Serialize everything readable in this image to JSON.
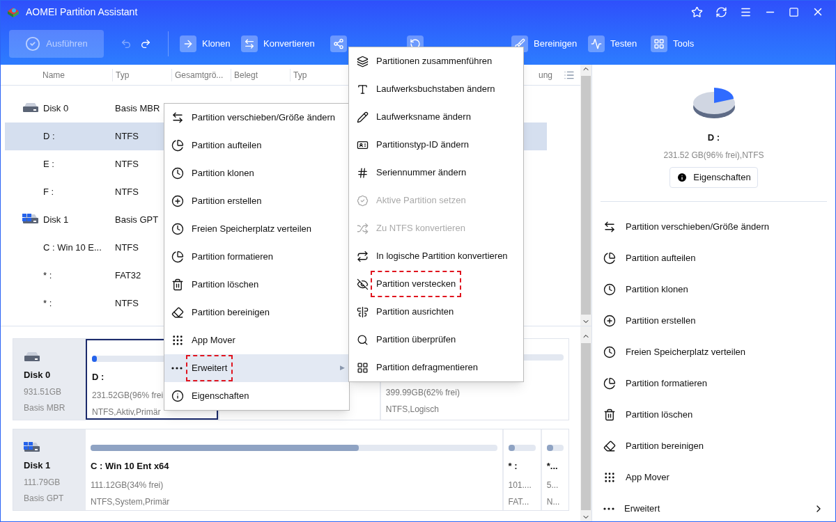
{
  "window": {
    "title": "AOMEI Partition Assistant"
  },
  "toolbar": {
    "apply": {
      "label": "Ausführen",
      "disabled": true
    },
    "undo": {
      "disabled": true
    },
    "redo": {
      "disabled": false
    },
    "items": [
      {
        "kind": "labeled",
        "label": "Klonen"
      },
      {
        "kind": "labeled",
        "label": "Konvertieren"
      },
      {
        "kind": "covered"
      },
      {
        "kind": "covered"
      },
      {
        "kind": "labeled",
        "label": "Bereinigen"
      },
      {
        "kind": "labeled",
        "label": "Testen"
      },
      {
        "kind": "labeled",
        "label": "Tools"
      }
    ]
  },
  "table": {
    "columns": [
      "Name",
      "Typ",
      "Gesamtgrö...",
      "Belegt",
      "Typ",
      "ung"
    ],
    "rows": [
      {
        "kind": "disk",
        "name": "Disk 0",
        "type": "Basis MBR",
        "selected": false
      },
      {
        "kind": "partition",
        "name": "D :",
        "type": "NTFS",
        "selected": true
      },
      {
        "kind": "partition",
        "name": "E :",
        "type": "NTFS",
        "selected": false
      },
      {
        "kind": "partition",
        "name": "F :",
        "type": "NTFS",
        "selected": false
      },
      {
        "kind": "disk",
        "name": "Disk 1",
        "type": "Basis GPT",
        "selected": false
      },
      {
        "kind": "partition",
        "name": "C : Win 10 E...",
        "type": "NTFS",
        "selected": false
      },
      {
        "kind": "partition",
        "name": "* :",
        "type": "FAT32",
        "selected": false
      },
      {
        "kind": "partition",
        "name": "* :",
        "type": "NTFS",
        "selected": false
      }
    ]
  },
  "disk_map": [
    {
      "name": "Disk 0",
      "size": "931.51GB",
      "style": "Basis MBR",
      "partitions": [
        {
          "selected": true,
          "level": 0.04,
          "label": "D :",
          "size": "231.52GB(96% frei",
          "fs": "NTFS,Aktiv,Primär"
        },
        {
          "selected": false
        },
        {
          "selected": false,
          "size": "399.99GB(62% frei)",
          "fs": "NTFS,Logisch"
        }
      ]
    },
    {
      "name": "Disk 1",
      "size": "111.79GB",
      "style": "Basis GPT",
      "partitions": [
        {
          "selected": false,
          "level": 0.66,
          "label": "C : Win 10 Ent x64",
          "size": "111.12GB(34% frei)",
          "fs": "NTFS,System,Primär"
        },
        {
          "selected": false,
          "level": 0.25,
          "label": "* :",
          "size": "101....",
          "fs": "FAT..."
        },
        {
          "selected": false,
          "level": 0.4,
          "label": "*...",
          "size": "5...",
          "fs": "N..."
        }
      ]
    }
  ],
  "context_menu": [
    {
      "label": "Partition verschieben/Größe ändern",
      "selected": false,
      "annotated": false
    },
    {
      "label": "Partition aufteilen",
      "selected": false,
      "annotated": false
    },
    {
      "label": "Partition klonen",
      "selected": false,
      "annotated": false
    },
    {
      "label": "Partition erstellen",
      "selected": false,
      "annotated": false
    },
    {
      "label": "Freien Speicherplatz verteilen",
      "selected": false,
      "annotated": false
    },
    {
      "label": "Partition formatieren",
      "selected": false,
      "annotated": false
    },
    {
      "label": "Partition löschen",
      "selected": false,
      "annotated": false
    },
    {
      "label": "Partition bereinigen",
      "selected": false,
      "annotated": false
    },
    {
      "label": "App Mover",
      "selected": false,
      "annotated": false
    },
    {
      "label": "Erweitert",
      "selected": true,
      "annotated": true,
      "arrow": "▶"
    },
    {
      "label": "Eigenschaften",
      "selected": false,
      "annotated": false
    }
  ],
  "submenu": [
    {
      "label": "Partitionen zusammenführen",
      "disabled": false,
      "annotated": false
    },
    {
      "label": "Laufwerksbuchstaben ändern",
      "disabled": false,
      "annotated": false
    },
    {
      "label": "Laufwerksname ändern",
      "disabled": false,
      "annotated": false
    },
    {
      "label": "Partitionstyp-ID ändern",
      "disabled": false,
      "annotated": false
    },
    {
      "label": "Seriennummer ändern",
      "disabled": false,
      "annotated": false
    },
    {
      "label": "Aktive Partition setzen",
      "disabled": true,
      "annotated": false
    },
    {
      "label": "Zu NTFS konvertieren",
      "disabled": true,
      "annotated": false
    },
    {
      "label": "In logische Partition konvertieren",
      "disabled": false,
      "annotated": false
    },
    {
      "label": "Partition verstecken",
      "disabled": false,
      "annotated": true
    },
    {
      "label": "Partition ausrichten",
      "disabled": false,
      "annotated": false
    },
    {
      "label": "Partition überprüfen",
      "disabled": false,
      "annotated": false
    },
    {
      "label": "Partition defragmentieren",
      "disabled": false,
      "annotated": false
    }
  ],
  "details": {
    "name": "D :",
    "info": "231.52 GB(96% frei),NTFS",
    "button": "Eigenschaften"
  },
  "operations": [
    {
      "label": "Partition verschieben/Größe ändern",
      "submenu": false
    },
    {
      "label": "Partition aufteilen",
      "submenu": false
    },
    {
      "label": "Partition klonen",
      "submenu": false
    },
    {
      "label": "Partition erstellen",
      "submenu": false
    },
    {
      "label": "Freien Speicherplatz verteilen",
      "submenu": false
    },
    {
      "label": "Partition formatieren",
      "submenu": false
    },
    {
      "label": "Partition löschen",
      "submenu": false
    },
    {
      "label": "Partition bereinigen",
      "submenu": false
    },
    {
      "label": "App Mover",
      "submenu": false
    },
    {
      "label": "Erweitert",
      "submenu": true
    }
  ]
}
